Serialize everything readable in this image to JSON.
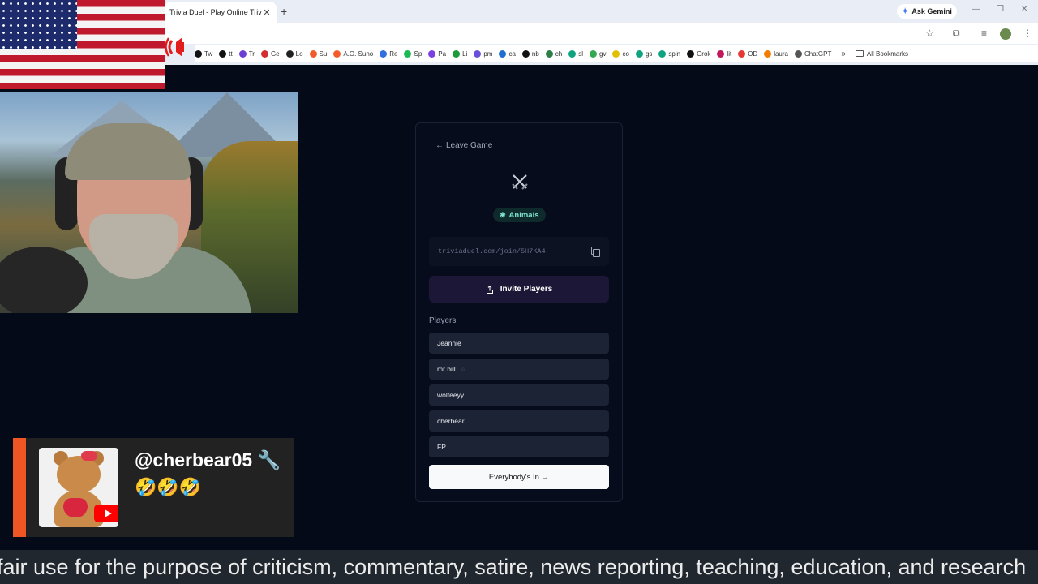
{
  "browser": {
    "tab_title": "Trivia Duel - Play Online Trivia",
    "tab_close": "✕",
    "new_tab": "+",
    "ask_gemini": "Ask Gemini",
    "window_controls": [
      "—",
      "❐",
      "✕"
    ],
    "bookmarks": [
      {
        "label": "Tw",
        "color": "#111111"
      },
      {
        "label": "tt",
        "color": "#111111"
      },
      {
        "label": "Tr",
        "color": "#6c3fd4"
      },
      {
        "label": "Ge",
        "color": "#d32f2f"
      },
      {
        "label": "Lo",
        "color": "#222222"
      },
      {
        "label": "Su",
        "color": "#f25c2a"
      },
      {
        "label": "A.O. Suno",
        "color": "#f25c2a"
      },
      {
        "label": "Re",
        "color": "#2f6fe0"
      },
      {
        "label": "Sp",
        "color": "#1db954"
      },
      {
        "label": "Pa",
        "color": "#7b3fe4"
      },
      {
        "label": "Li",
        "color": "#1c9b3a"
      },
      {
        "label": "pm",
        "color": "#6b4fd8"
      },
      {
        "label": "ca",
        "color": "#1f6fd1"
      },
      {
        "label": "nb",
        "color": "#111111"
      },
      {
        "label": "ch",
        "color": "#2d7d46"
      },
      {
        "label": "sl",
        "color": "#10a37f"
      },
      {
        "label": "gv",
        "color": "#34a853"
      },
      {
        "label": "co",
        "color": "#e0c000"
      },
      {
        "label": "gs",
        "color": "#10a37f"
      },
      {
        "label": "spin",
        "color": "#10a37f"
      },
      {
        "label": "Grok",
        "color": "#111111"
      },
      {
        "label": "lit",
        "color": "#c2185b"
      },
      {
        "label": "OD",
        "color": "#e53935"
      },
      {
        "label": "laura",
        "color": "#f57c00"
      },
      {
        "label": "ChatGPT",
        "color": "#555555"
      }
    ],
    "bookmarks_more": "»",
    "all_bookmarks": "All Bookmarks"
  },
  "game": {
    "leave_arrow": "←",
    "leave_label": "Leave Game",
    "category": "Animals",
    "invite_link": "triviaduel.com/join/5H7KA4",
    "invite_button": "Invite Players",
    "players_heading": "Players",
    "players": [
      {
        "name": "Jeannie",
        "star": ""
      },
      {
        "name": "mr bill",
        "star": "☆"
      },
      {
        "name": "wolfeeyy",
        "star": ""
      },
      {
        "name": "cherbear",
        "star": ""
      },
      {
        "name": "FP",
        "star": ""
      }
    ],
    "ready_button": "Everybody's In →"
  },
  "chat": {
    "username": "@cherbear05 🔧",
    "message": "🤣🤣🤣"
  },
  "disclaimer": "fair use for the purpose of criticism, commentary, satire, news reporting, teaching, education, and research"
}
